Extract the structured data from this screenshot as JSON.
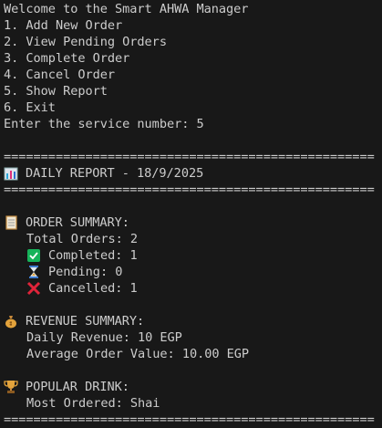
{
  "menu": {
    "welcome": "Welcome to the Smart AHWA Manager",
    "items": [
      "1. Add New Order",
      "2. View Pending Orders",
      "3. Complete Order",
      "4. Cancel Order",
      "5. Show Report",
      "6. Exit"
    ],
    "prompt": "Enter the service number: 5"
  },
  "report": {
    "separator": "==================================================",
    "title": "DAILY REPORT - 18/9/2025",
    "title_icon": "bar-chart-icon",
    "order_summary": {
      "icon": "clipboard-icon",
      "heading": "ORDER SUMMARY:",
      "total": "Total Orders: 2",
      "completed": "Completed: 1",
      "completed_icon": "check-mark-icon",
      "pending": "Pending: 0",
      "pending_icon": "hourglass-icon",
      "cancelled": "Cancelled: 1",
      "cancelled_icon": "cross-mark-icon"
    },
    "revenue_summary": {
      "icon": "money-bag-icon",
      "heading": "REVENUE SUMMARY:",
      "daily": "Daily Revenue: 10 EGP",
      "average": "Average Order Value: 10.00 EGP"
    },
    "popular_drink": {
      "icon": "trophy-icon",
      "heading": "POPULAR DRINK:",
      "most_ordered": "Most Ordered: Shai"
    }
  },
  "colors": {
    "background": "#181818",
    "text": "#cccccc",
    "check": "#16b35a",
    "cross": "#e0243a",
    "gold": "#e3a33c"
  }
}
